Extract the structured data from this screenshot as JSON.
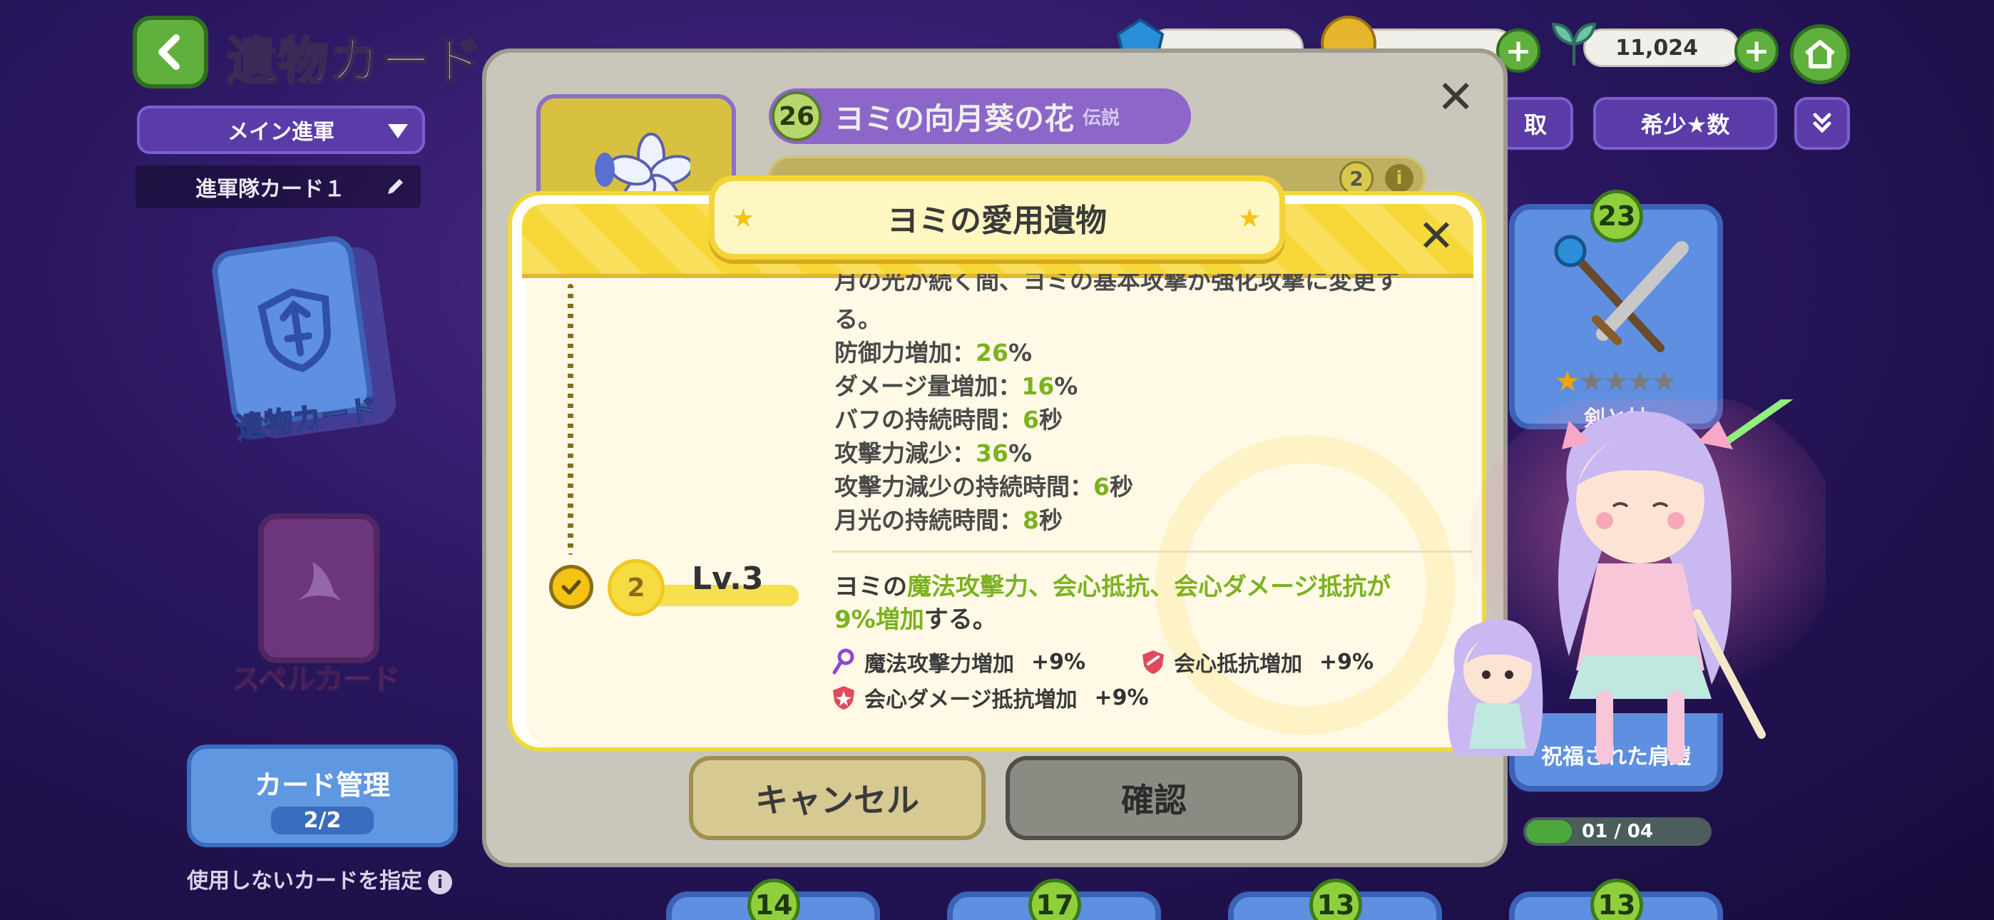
{
  "header": {
    "title": "遺物カード",
    "deck_select": "メイン進軍",
    "deck_name": "進軍隊カード１"
  },
  "resources": {
    "gem": {
      "value": "",
      "icon": "gem-icon"
    },
    "coin": {
      "value": "",
      "icon": "coin-icon"
    },
    "sprout": {
      "value": "11,024",
      "icon": "sprout-icon"
    }
  },
  "filters": {
    "rarity": "希少★数",
    "partial": "取"
  },
  "sidebar": {
    "relic_card": "遺物カード",
    "spell_card": "スペルカード",
    "manage_label": "カード管理",
    "manage_count": "2/2",
    "unused_text": "使用しないカードを指定"
  },
  "right_cards": {
    "top": {
      "level": "23",
      "name": "剣と杖",
      "stars": 1,
      "max_stars": 5
    },
    "bottom": {
      "name": "祝福された肩鎧"
    },
    "progress": {
      "text": "01 / 04",
      "fraction": 0.25
    }
  },
  "bottom_levels": [
    "14",
    "17",
    "13",
    "13"
  ],
  "item_dialog": {
    "level": "26",
    "name": "ヨミの向月葵の花",
    "rarity": "伝説",
    "sub_badge": "2",
    "cancel": "キャンセル",
    "confirm": "確認"
  },
  "popup": {
    "title": "ヨミの愛用遺物",
    "level_label": "Lv.3",
    "level_coin": "2",
    "desc_top": "月の光が続く間、ヨミの基本攻撃が強化攻撃に変更す",
    "desc_end": "る。",
    "lines": [
      {
        "label": "防御力増加：",
        "value": "26",
        "unit": "%"
      },
      {
        "label": "ダメージ量増加：",
        "value": "16",
        "unit": "%"
      },
      {
        "label": "バフの持続時間：",
        "value": "6",
        "unit": "秒"
      },
      {
        "label": "攻擊力減少：",
        "value": "36",
        "unit": "%"
      },
      {
        "label": "攻擊力減少の持続時間：",
        "value": "6",
        "unit": "秒"
      },
      {
        "label": "月光の持続時間：",
        "value": "8",
        "unit": "秒"
      }
    ],
    "effect": {
      "prefix": "ヨミの",
      "highlight": "魔法攻擊力、会心抵抗、会心ダメージ抵抗が",
      "highlight2": "9%増加",
      "suffix": "する。"
    },
    "stats": [
      {
        "label": "魔法攻擊力増加",
        "value": "+9%",
        "icon": "magic-staff-icon"
      },
      {
        "label": "会心抵抗増加",
        "value": "+9%",
        "icon": "shield-icon"
      },
      {
        "label": "会心ダメージ抵抗増加",
        "value": "+9%",
        "icon": "shield-burst-icon"
      }
    ]
  },
  "colors": {
    "accent_green": "#7bb21e",
    "popup_yellow": "#f6d838",
    "purple_ui": "#5a3ba8"
  }
}
